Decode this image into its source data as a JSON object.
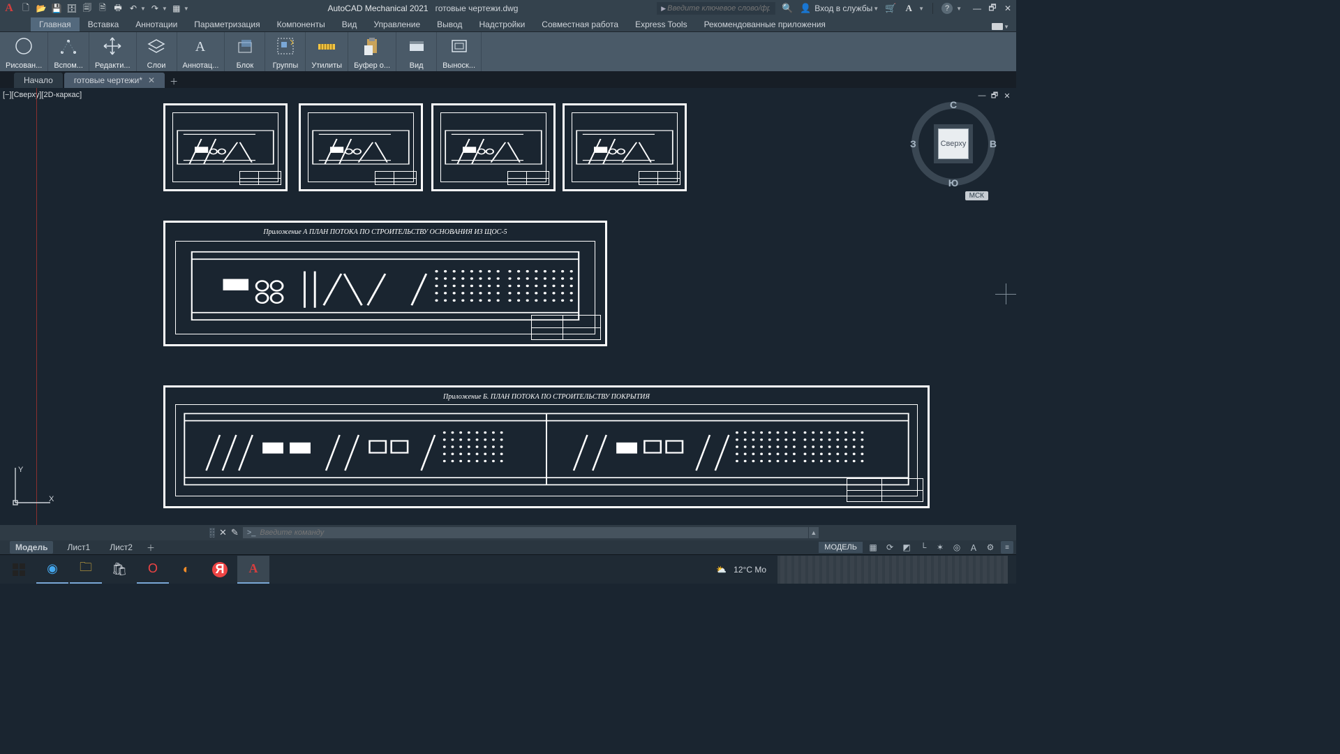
{
  "app": {
    "name_glyph": "A",
    "title": "AutoCAD Mechanical 2021",
    "document": "готовые чертежи.dwg"
  },
  "qat": {
    "new": "🗋",
    "open": "📂",
    "save": "💾",
    "saveall": "🗄",
    "plot": "🗐",
    "publish": "🗎",
    "print": "🖶",
    "undo": "↶",
    "redo": "↷",
    "more": "▦"
  },
  "search": {
    "placeholder": "Введите ключевое слово/фразу"
  },
  "signin": {
    "label": "Вход в службы"
  },
  "help_glyph": "?",
  "ribbon_tabs": [
    "Главная",
    "Вставка",
    "Аннотации",
    "Параметризация",
    "Компоненты",
    "Вид",
    "Управление",
    "Вывод",
    "Надстройки",
    "Совместная работа",
    "Express Tools",
    "Рекомендованные приложения"
  ],
  "ribbon_panels": [
    {
      "label": "Рисован..."
    },
    {
      "label": "Вспом..."
    },
    {
      "label": "Редакти..."
    },
    {
      "label": "Слои"
    },
    {
      "label": "Аннотац..."
    },
    {
      "label": "Блок"
    },
    {
      "label": "Группы"
    },
    {
      "label": "Утилиты"
    },
    {
      "label": "Буфер о..."
    },
    {
      "label": "Вид"
    },
    {
      "label": "Выноск..."
    }
  ],
  "file_tabs": {
    "start": "Начало",
    "active": "готовые чертежи*"
  },
  "viewport_label": "[−][Сверху][2D-каркас]",
  "viewcube": {
    "face": "Сверху",
    "n": "С",
    "s": "Ю",
    "e": "В",
    "w": "З",
    "wcs": "МСК"
  },
  "ucs": {
    "x": "X",
    "y": "Y"
  },
  "drawings": {
    "plan_a": "Приложение А ПЛАН ПОТОКА ПО СТРОИТЕЛЬСТВУ ОСНОВАНИЯ ИЗ ЩОС-5",
    "plan_b": "Приложение Б. ПЛАН ПОТОКА ПО СТРОИТЕЛЬСТВУ ПОКРЫТИЯ"
  },
  "cmd": {
    "placeholder": "Введите команду",
    "prompt": ">_"
  },
  "model_tabs": {
    "model": "Модель",
    "layout1": "Лист1",
    "layout2": "Лист2"
  },
  "status": {
    "model_chip": "МОДЕЛЬ"
  },
  "taskbar": {
    "weather": "12°C  Mo"
  }
}
